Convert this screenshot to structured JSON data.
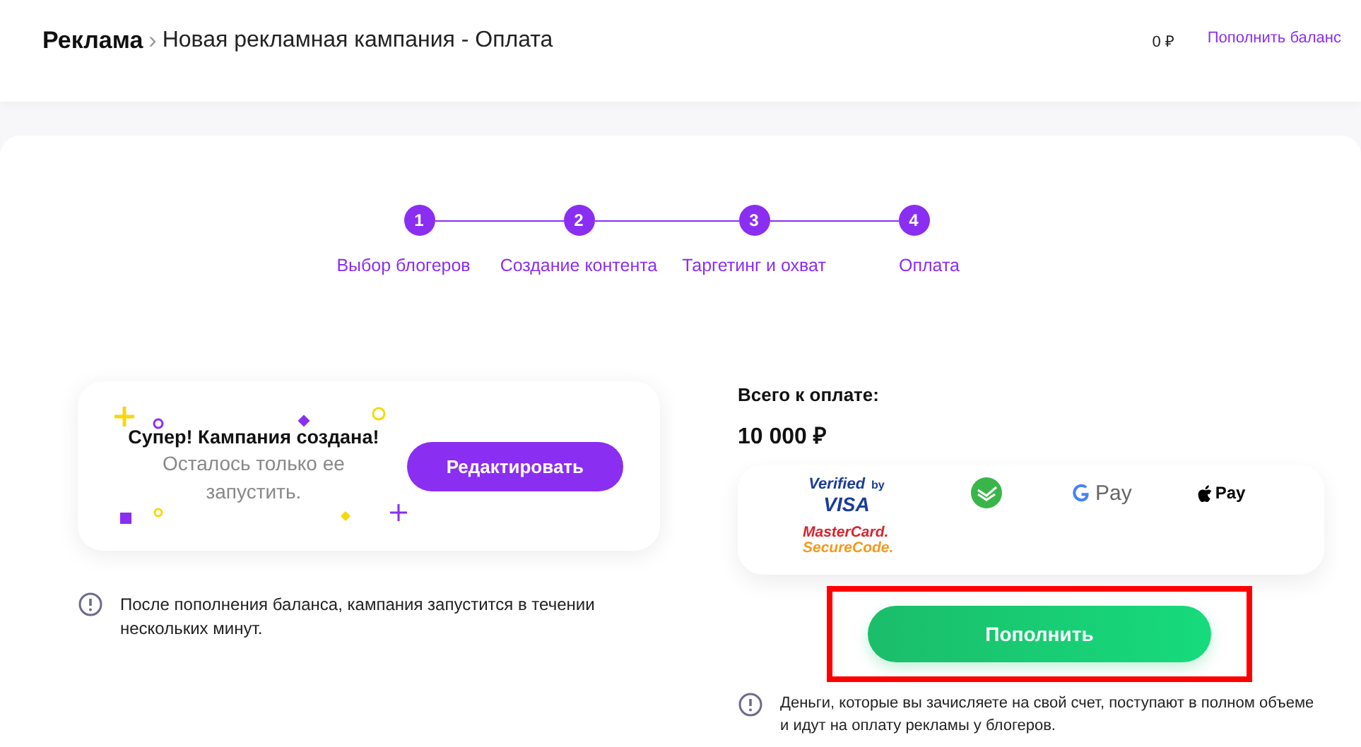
{
  "header": {
    "section": "Реклама",
    "separator": "›",
    "title": "Новая рекламная кампания - Оплата",
    "balance": "0 ₽",
    "topup_link": "Пополнить баланс"
  },
  "steps": [
    {
      "number": "1",
      "label": "Выбор блогеров",
      "done": true
    },
    {
      "number": "2",
      "label": "Создание контента",
      "done": true
    },
    {
      "number": "3",
      "label": "Таргетинг и охват",
      "done": true
    },
    {
      "number": "4",
      "label": "Оплата",
      "done": true
    }
  ],
  "success_card": {
    "title": "Супер! Кампания создана!",
    "subtitle": "Осталось только ее запустить.",
    "edit_button": "Редактировать"
  },
  "left_note": "После пополнения баланса, кампания запустится в течении нескольких минут.",
  "total": {
    "label": "Всего к оплате:",
    "amount": "10 000 ₽"
  },
  "payment_methods": [
    {
      "kind": "visa",
      "texts": [
        "Verified",
        "by",
        "VISA"
      ]
    },
    {
      "kind": "sber"
    },
    {
      "kind": "gpay",
      "texts": [
        "Pay"
      ]
    },
    {
      "kind": "applepay",
      "texts": [
        "Pay"
      ]
    },
    {
      "kind": "mastercard",
      "texts": [
        "MasterCard.",
        "SecureCode."
      ]
    }
  ],
  "pay_button": {
    "label": "Пополнить",
    "highlighted": true
  },
  "right_note": "Деньги, которые вы зачисляете на свой счет, поступают в полном объеме и идут на оплату рекламы у блогеров."
}
